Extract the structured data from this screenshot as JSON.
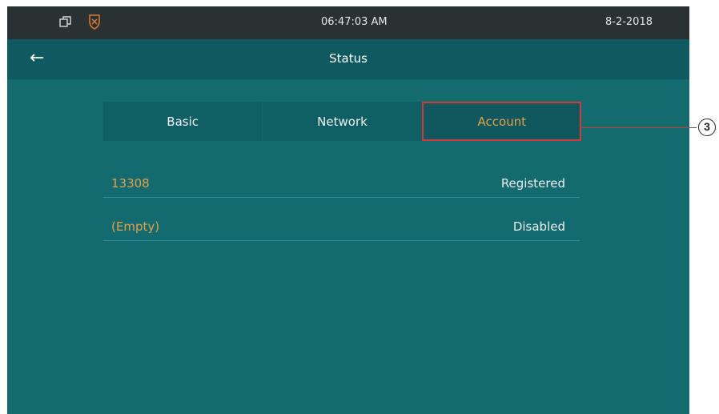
{
  "status_bar": {
    "time": "06:47:03   AM",
    "date": "8-2-2018",
    "icons": [
      "window-icon",
      "shield-icon"
    ]
  },
  "header": {
    "back_icon": "arrow-left-icon",
    "back_glyph": "←",
    "title": "Status"
  },
  "tabs": [
    {
      "label": "Basic",
      "active": false
    },
    {
      "label": "Network",
      "active": false
    },
    {
      "label": "Account",
      "active": true
    }
  ],
  "accounts": [
    {
      "name": "13308",
      "status": "Registered"
    },
    {
      "name": "(Empty)",
      "status": "Disabled"
    }
  ],
  "callout": {
    "number": "3"
  },
  "colors": {
    "background": "#136b70",
    "status_bar": "#2a3133",
    "accent": "#e2a04b",
    "highlight": "#d23b3b"
  }
}
